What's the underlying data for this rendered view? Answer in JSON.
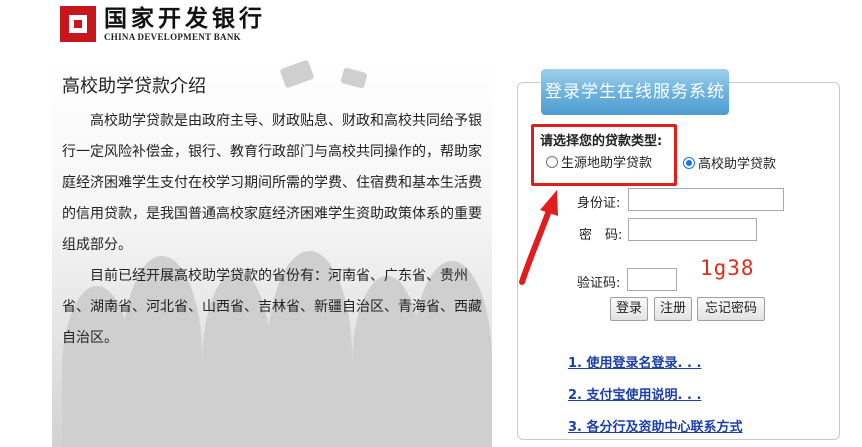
{
  "logo": {
    "cn": "国家开发银行",
    "en": "CHINA DEVELOPMENT BANK"
  },
  "intro": {
    "title": "高校助学贷款介绍",
    "paragraphs": [
      "高校助学贷款是由政府主导、财政贴息、财政和高校共同给予银行一定风险补偿金，银行、教育行政部门与高校共同操作的，帮助家庭经济困难学生支付在校学习期间所需的学费、住宿费和基本生活费的信用贷款，是我国普通高校家庭经济困难学生资助政策体系的重要组成部分。",
      "目前已经开展高校助学贷款的省份有：河南省、广东省、贵州省、湖南省、河北省、山西省、吉林省、新疆自治区、青海省、西藏自治区。"
    ]
  },
  "login": {
    "header": "登录学生在线服务系统",
    "loan_type_label": "请选择您的贷款类型:",
    "loan_options": [
      {
        "label": "生源地助学贷款",
        "selected": false
      },
      {
        "label": "高校助学贷款",
        "selected": true
      }
    ],
    "id_label": "身份证:",
    "id_value": "",
    "password_label": "密　码:",
    "password_value": "",
    "captcha_label": "验证码:",
    "captcha_value": "",
    "captcha_image_text": "1g38",
    "buttons": {
      "login": "登录",
      "register": "注册",
      "forgot": "忘记密码"
    },
    "links": [
      "1. 使用登录名登录. . .",
      "2. 支付宝使用说明. . .",
      "3. 各分行及资助中心联系方式"
    ]
  },
  "colors": {
    "highlight": "#e01e1e",
    "link": "#1c3fa8",
    "header": "#6bb0dc",
    "captcha": "#d8301a"
  }
}
